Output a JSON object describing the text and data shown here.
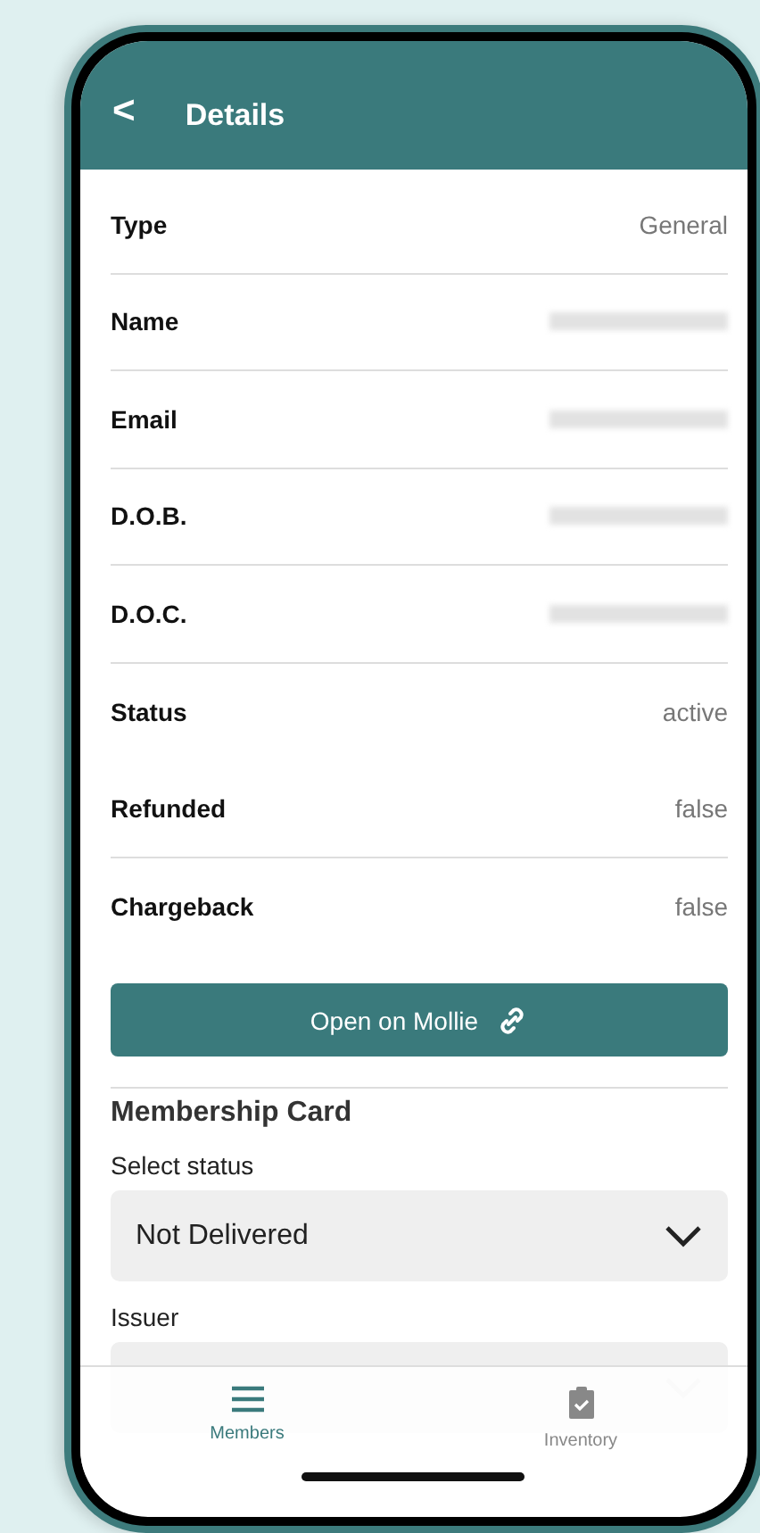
{
  "header": {
    "back": "<",
    "title": "Details"
  },
  "rows": [
    {
      "label": "Type",
      "value": "General",
      "kind": "text",
      "divider": true
    },
    {
      "label": "Name",
      "kind": "redacted",
      "divider": true
    },
    {
      "label": "Email",
      "kind": "redacted",
      "divider": true
    },
    {
      "label": "D.O.B.",
      "kind": "redacted",
      "divider": true
    },
    {
      "label": "D.O.C.",
      "kind": "redacted",
      "divider": true
    },
    {
      "label": "Status",
      "value": "active",
      "kind": "text",
      "divider": false
    },
    {
      "label": "Refunded",
      "value": "false",
      "kind": "text",
      "divider": true
    },
    {
      "label": "Chargeback",
      "value": "false",
      "kind": "text",
      "divider": false
    }
  ],
  "open_button": {
    "label": "Open on Mollie"
  },
  "membership_card": {
    "title": "Membership Card",
    "fields": [
      {
        "label": "Select status",
        "value": "Not Delivered"
      },
      {
        "label": "Issuer"
      }
    ]
  },
  "tabs": [
    {
      "label": "Members",
      "selected": true,
      "kind": "list"
    },
    {
      "label": "Inventory",
      "selected": false,
      "kind": "clipboard"
    }
  ]
}
